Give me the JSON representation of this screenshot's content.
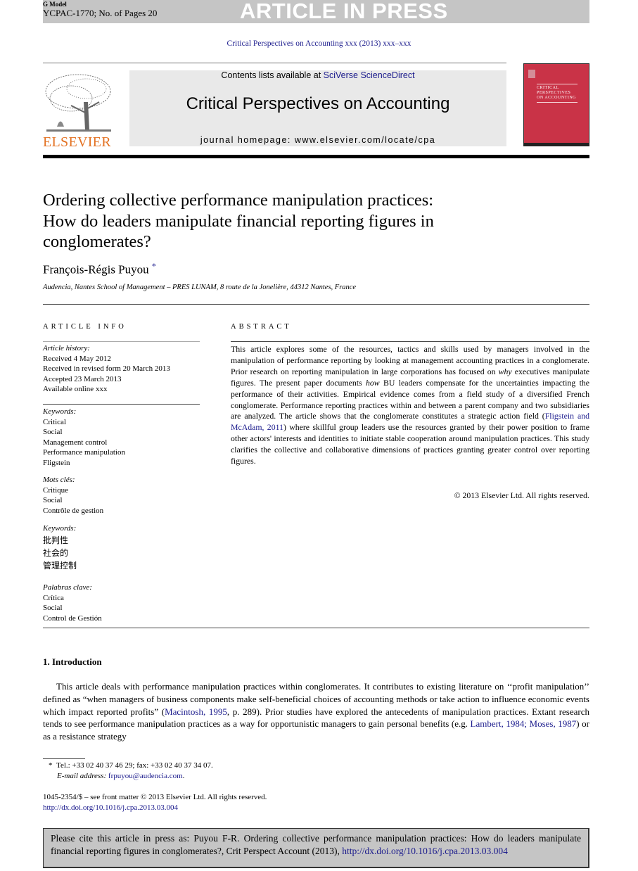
{
  "header": {
    "g_model": "G Model",
    "manuscript_id": "YCPAC-1770; No. of Pages 20",
    "banner": "ARTICLE IN PRESS",
    "journal_citation_line": "Critical Perspectives on Accounting xxx (2013) xxx–xxx"
  },
  "masthead": {
    "publisher_logo_text": "ELSEVIER",
    "contents_prefix": "Contents lists available at ",
    "contents_link": "SciVerse ScienceDirect",
    "journal_title": "Critical Perspectives on Accounting",
    "homepage": "journal homepage: www.elsevier.com/locate/cpa",
    "cover_text_lines": [
      "CRITICAL",
      "PERSPECTIVES",
      "ON ACCOUNTING"
    ],
    "cover_color": "#c93347",
    "publisher_color": "#e37223"
  },
  "article": {
    "title_lines": [
      "Ordering collective performance manipulation practices:",
      "How do leaders manipulate financial reporting figures in",
      "conglomerates?"
    ],
    "author": "François-Régis Puyou",
    "author_mark": "*",
    "affiliation": "Audencia, Nantes School of Management – PRES LUNAM, 8 route de la Jonelière, 44312 Nantes, France"
  },
  "article_info": {
    "heading": "ARTICLE INFO",
    "history_label": "Article history:",
    "history": [
      "Received 4 May 2012",
      "Received in revised form 20 March 2013",
      "Accepted 23 March 2013",
      "Available online xxx"
    ],
    "keyword_groups": [
      {
        "label": "Keywords:",
        "items": [
          "Critical",
          "Social",
          "Management control",
          "Performance manipulation",
          "Fligstein"
        ]
      },
      {
        "label": "Mots clés:",
        "items": [
          "Critique",
          "Social",
          "Contrôle de gestion"
        ]
      },
      {
        "label": "Keywords:",
        "items": [
          "批判性",
          "社会的",
          "管理控制"
        ]
      },
      {
        "label": "Palabras clave:",
        "items": [
          "Crítica",
          "Social",
          "Control de Gestión"
        ]
      }
    ]
  },
  "abstract": {
    "heading": "ABSTRACT",
    "p1": "This article explores some of the resources, tactics and skills used by managers involved in the manipulation of performance reporting by looking at management accounting practices in a conglomerate. Prior research on reporting manipulation in large corporations has focused on ",
    "em1": "why",
    "p2": " executives manipulate figures. The present paper documents ",
    "em2": "how",
    "p3": " BU leaders compensate for the uncertainties impacting the performance of their activities. Empirical evidence comes from a field study of a diversified French conglomerate. Performance reporting practices within and between a parent company and two subsidiaries are analyzed. The article shows that the conglomerate constitutes a strategic action field (",
    "ref1": "Fligstein and McAdam, 2011",
    "p4": ") where skillful group leaders use the resources granted by their power position to frame other actors' interests and identities to initiate stable cooperation around manipulation practices. This study clarifies the collective and collaborative dimensions of practices granting greater control over reporting figures.",
    "copyright": "© 2013 Elsevier Ltd. All rights reserved."
  },
  "introduction": {
    "heading": "1.  Introduction",
    "t1": "This article deals with performance manipulation practices within conglomerates. It contributes to existing literature on ‘‘profit manipulation’’ defined as “when managers of business components make self-beneficial choices of accounting methods or take action to influence economic events which impact reported profits” (",
    "ref1": "Macintosh, 1995",
    "t2": ", p. 289). Prior studies have explored the antecedents of manipulation practices. Extant research tends to see performance manipulation practices as a way for opportunistic managers to gain personal benefits (e.g. ",
    "ref2": "Lambert, 1984; Moses, 1987",
    "t3": ") or as a resistance strategy"
  },
  "footnotes": {
    "mark": "*",
    "contact": "Tel.: +33 02 40 37 46 29; fax: +33 02 40 37 34 07.",
    "email_label": "E-mail address: ",
    "email": "frpuyou@audencia.com",
    "email_suffix": ".",
    "front_matter": "1045-2354/$ – see front matter © 2013 Elsevier Ltd. All rights reserved.",
    "doi": "http://dx.doi.org/10.1016/j.cpa.2013.03.004"
  },
  "cite_box": {
    "text": "Please cite this article in press as: Puyou F-R. Ordering collective performance manipulation practices: How do leaders manipulate financial reporting figures in conglomerates?, Crit Perspect Account (2013), ",
    "link": "http://dx.doi.org/10.1016/j.cpa.2013.03.004"
  }
}
